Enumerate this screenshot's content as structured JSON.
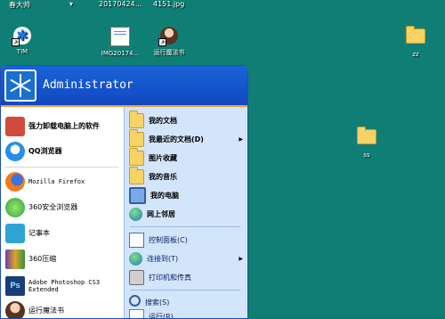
{
  "top_row": {
    "item1": "春大帅",
    "item2": "▾",
    "item3": "20170424...",
    "item4": "4151.jpg"
  },
  "desktop_icons": [
    {
      "label": "TIM"
    },
    {
      "label": "IMG20174..."
    },
    {
      "label": "运行魔法书"
    },
    {
      "label": "zz"
    },
    {
      "label": "ss"
    }
  ],
  "start_menu": {
    "user": "Administrator",
    "left_items": [
      {
        "label": "强力卸载电脑上的软件"
      },
      {
        "label": "QQ浏览器"
      },
      {
        "label": "Mozilla Firefox"
      },
      {
        "label": "360安全浏览器"
      },
      {
        "label": "记事本"
      },
      {
        "label": "360压缩"
      },
      {
        "label": "Adobe Photoshop CS3 Extended"
      },
      {
        "label": "运行魔法书"
      }
    ],
    "right_items": [
      {
        "label": "我的文档"
      },
      {
        "label": "我最近的文档(D)"
      },
      {
        "label": "图片收藏"
      },
      {
        "label": "我的音乐"
      },
      {
        "label": "我的电脑"
      },
      {
        "label": "网上邻居"
      },
      {
        "label": "控制面板(C)"
      },
      {
        "label": "连接到(T)"
      },
      {
        "label": "打印机和传真"
      },
      {
        "label": "搜索(S)"
      },
      {
        "label": "运行(R)..."
      }
    ],
    "arrow": "▶",
    "ps_badge": "Ps"
  },
  "colors": {
    "desktop": "#0f7f76",
    "header": "#1a63d8",
    "right_pane": "#d3e5fa",
    "accent_line": "#f29c3e"
  }
}
